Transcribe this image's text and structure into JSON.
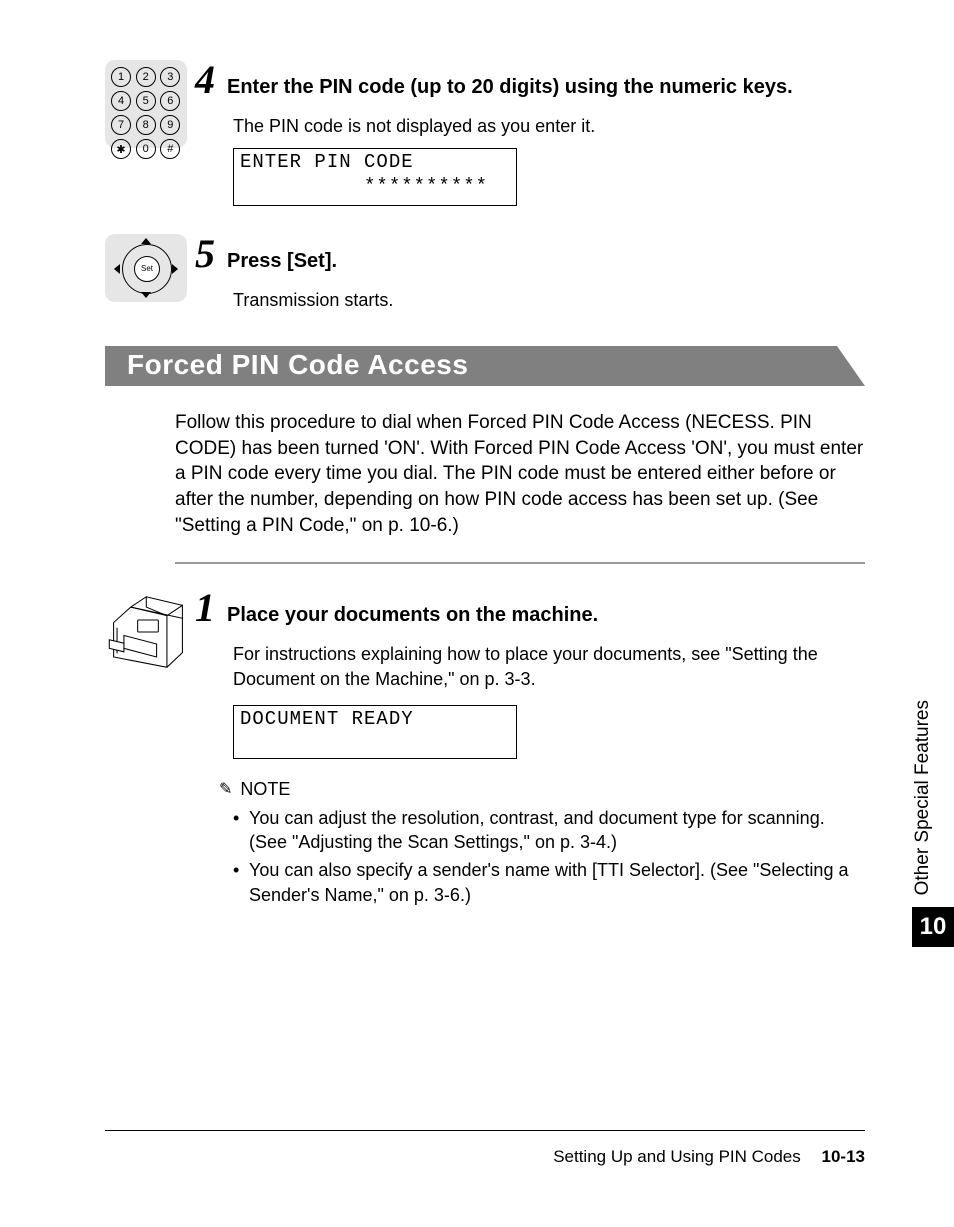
{
  "step4": {
    "number": "4",
    "title": "Enter the PIN code (up to 20 digits) using the numeric keys.",
    "desc": "The PIN code is not displayed as you enter it.",
    "lcd": "ENTER PIN CODE\n          **********"
  },
  "step5": {
    "number": "5",
    "title": "Press [Set].",
    "desc": "Transmission starts."
  },
  "section": {
    "title": "Forced PIN Code Access",
    "para": "Follow this procedure to dial when Forced PIN Code Access (NECESS. PIN CODE) has been turned 'ON'. With Forced PIN Code Access 'ON', you must enter a PIN code every time you dial. The PIN code must be entered either before or after the number, depending on how PIN code access has been set up. (See \"Setting a PIN Code,\" on p. 10-6.)"
  },
  "step1": {
    "number": "1",
    "title": "Place your documents on the machine.",
    "desc": "For instructions explaining how to place your documents, see \"Setting the Document on the Machine,\" on p. 3-3.",
    "lcd": "DOCUMENT READY"
  },
  "note": {
    "label": "NOTE",
    "items": [
      "You can adjust the resolution, contrast, and document type for scanning. (See \"Adjusting the Scan Settings,\" on p. 3-4.)",
      "You can also specify a sender's name with [TTI Selector]. (See \"Selecting a Sender's Name,\" on p. 3-6.)"
    ]
  },
  "sidetab": {
    "label": "Other Special Features",
    "number": "10"
  },
  "footer": {
    "text": "Setting Up and Using PIN Codes",
    "page": "10-13"
  },
  "keypad": [
    "1",
    "2",
    "3",
    "4",
    "5",
    "6",
    "7",
    "8",
    "9",
    "✱",
    "0",
    "#"
  ],
  "setLabel": "Set"
}
